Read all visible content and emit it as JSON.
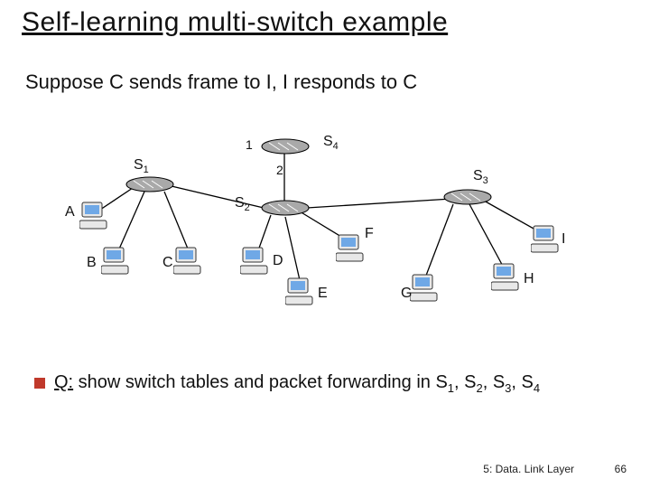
{
  "title": "Self-learning multi-switch example",
  "subtitle": "Suppose C sends frame to I, I responds to C",
  "switches": {
    "s1": "S",
    "s1_sub": "1",
    "s2": "S",
    "s2_sub": "2",
    "s3": "S",
    "s3_sub": "3",
    "s4": "S",
    "s4_sub": "4"
  },
  "ports": {
    "p1": "1",
    "p2": "2"
  },
  "hosts": {
    "A": "A",
    "B": "B",
    "C": "C",
    "D": "D",
    "E": "E",
    "F": "F",
    "G": "G",
    "H": "H",
    "I": "I"
  },
  "question_label": "Q:",
  "question_text_1": " show switch tables and packet forwarding in S",
  "question_comma": ", S",
  "footer": "5: Data. Link Layer",
  "page_num": "66",
  "subs": {
    "one": "1",
    "two": "2",
    "three": "3",
    "four": "4"
  }
}
